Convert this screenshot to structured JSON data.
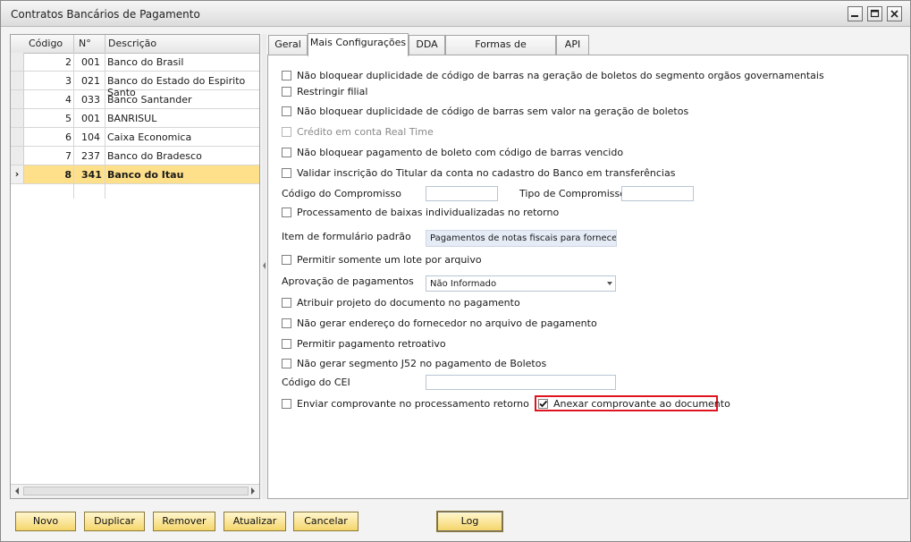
{
  "window": {
    "title": "Contratos Bancários de Pagamento"
  },
  "grid": {
    "headers": {
      "code": "Código",
      "num": "N°",
      "desc": "Descrição"
    },
    "rows": [
      {
        "code": "2",
        "num": "001",
        "desc": "Banco do Brasil"
      },
      {
        "code": "3",
        "num": "021",
        "desc": "Banco do Estado  do Espirito Santo"
      },
      {
        "code": "4",
        "num": "033",
        "desc": "Banco Santander"
      },
      {
        "code": "5",
        "num": "001",
        "desc": "BANRISUL"
      },
      {
        "code": "6",
        "num": "104",
        "desc": "Caixa Economica"
      },
      {
        "code": "7",
        "num": "237",
        "desc": "Banco do Bradesco"
      },
      {
        "code": "8",
        "num": "341",
        "desc": "Banco do Itau"
      }
    ],
    "selected_indicator": "›"
  },
  "tabs": [
    "Geral",
    "Mais Configurações",
    "DDA",
    "Formas de Pagamento",
    "API"
  ],
  "active_tab": "Mais Configurações",
  "settings": {
    "opt1": "Não bloquear duplicidade de código de barras na geração de boletos do segmento orgãos governamentais",
    "opt2": "Restringir filial",
    "opt3": "Não bloquear duplicidade de código de barras sem valor na geração de boletos",
    "opt4": "Crédito em conta Real Time",
    "opt5": "Não bloquear pagamento de boleto com código de barras vencido",
    "opt6": "Validar inscrição do Titular da conta no cadastro do Banco em transferências",
    "codigo_compromisso_label": "Código do Compromisso",
    "codigo_compromisso_value": "",
    "tipo_compromisso_label": "Tipo de Compromisso",
    "tipo_compromisso_value": "",
    "opt7": "Processamento de baixas individualizadas no retorno",
    "item_formulario_label": "Item de formulário padrão",
    "item_formulario_value": "Pagamentos de notas fiscais para fornece...",
    "opt8": "Permitir somente um lote por arquivo",
    "aprovacao_label": "Aprovação de pagamentos",
    "aprovacao_value": "Não Informado",
    "opt9": "Atribuir projeto do documento no pagamento",
    "opt10": "Não gerar endereço do fornecedor no arquivo de pagamento",
    "opt11": "Permitir pagamento retroativo",
    "opt12": "Não gerar segmento J52 no pagamento de Boletos",
    "cei_label": "Código do CEI",
    "cei_value": "",
    "opt13": "Enviar comprovante no processamento retorno",
    "opt14": "Anexar comprovante ao documento",
    "opt14_checked": true
  },
  "buttons": {
    "novo": "Novo",
    "duplicar": "Duplicar",
    "remover": "Remover",
    "atualizar": "Atualizar",
    "cancelar": "Cancelar",
    "log": "Log"
  },
  "colors": {
    "highlight": "#e0141e",
    "selected_row": "#ffe08a",
    "button": "#f5d66a"
  }
}
